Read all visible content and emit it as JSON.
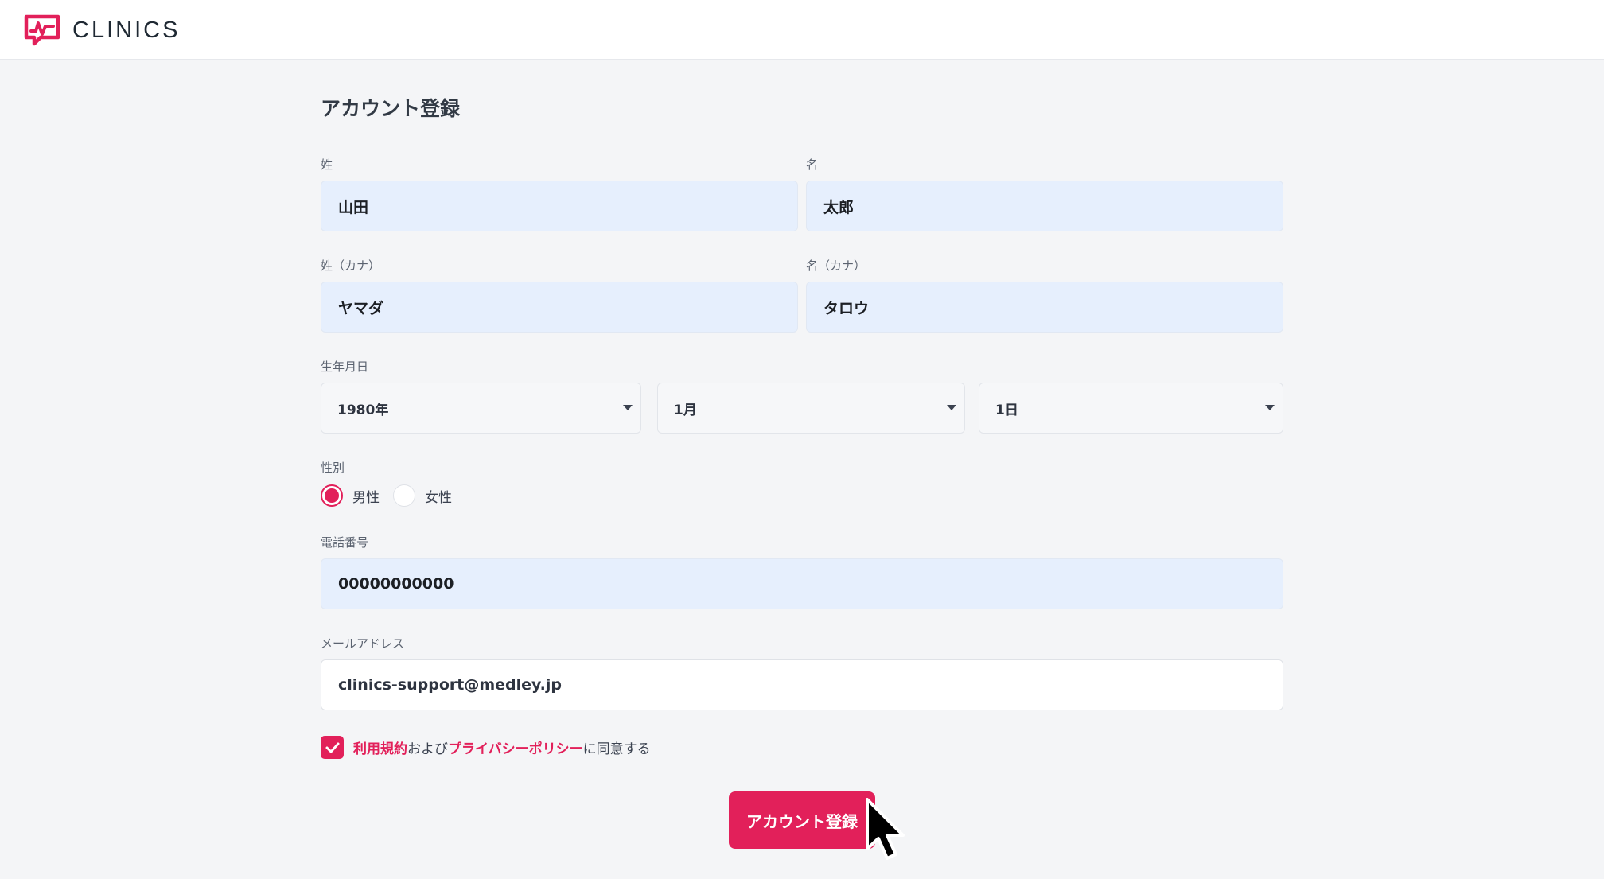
{
  "brand": {
    "name": "CLINICS",
    "accent": "#e2205a"
  },
  "page": {
    "title": "アカウント登録"
  },
  "form": {
    "last_name": {
      "label": "姓",
      "value": "山田"
    },
    "first_name": {
      "label": "名",
      "value": "太郎"
    },
    "last_name_kana": {
      "label": "姓（カナ）",
      "value": "ヤマダ"
    },
    "first_name_kana": {
      "label": "名（カナ）",
      "value": "タロウ"
    },
    "birthdate": {
      "label": "生年月日",
      "year": "1980年",
      "month": "1月",
      "day": "1日"
    },
    "gender": {
      "label": "性別",
      "options": [
        "男性",
        "女性"
      ],
      "selected": "男性"
    },
    "phone": {
      "label": "電話番号",
      "value": "00000000000"
    },
    "email": {
      "label": "メールアドレス",
      "value": "clinics-support@medley.jp"
    },
    "agreement": {
      "checked": true,
      "terms_link": "利用規約",
      "and_text": "および",
      "privacy_link": "プライバシーポリシー",
      "suffix_text": "に同意する"
    },
    "submit_label": "アカウント登録"
  }
}
